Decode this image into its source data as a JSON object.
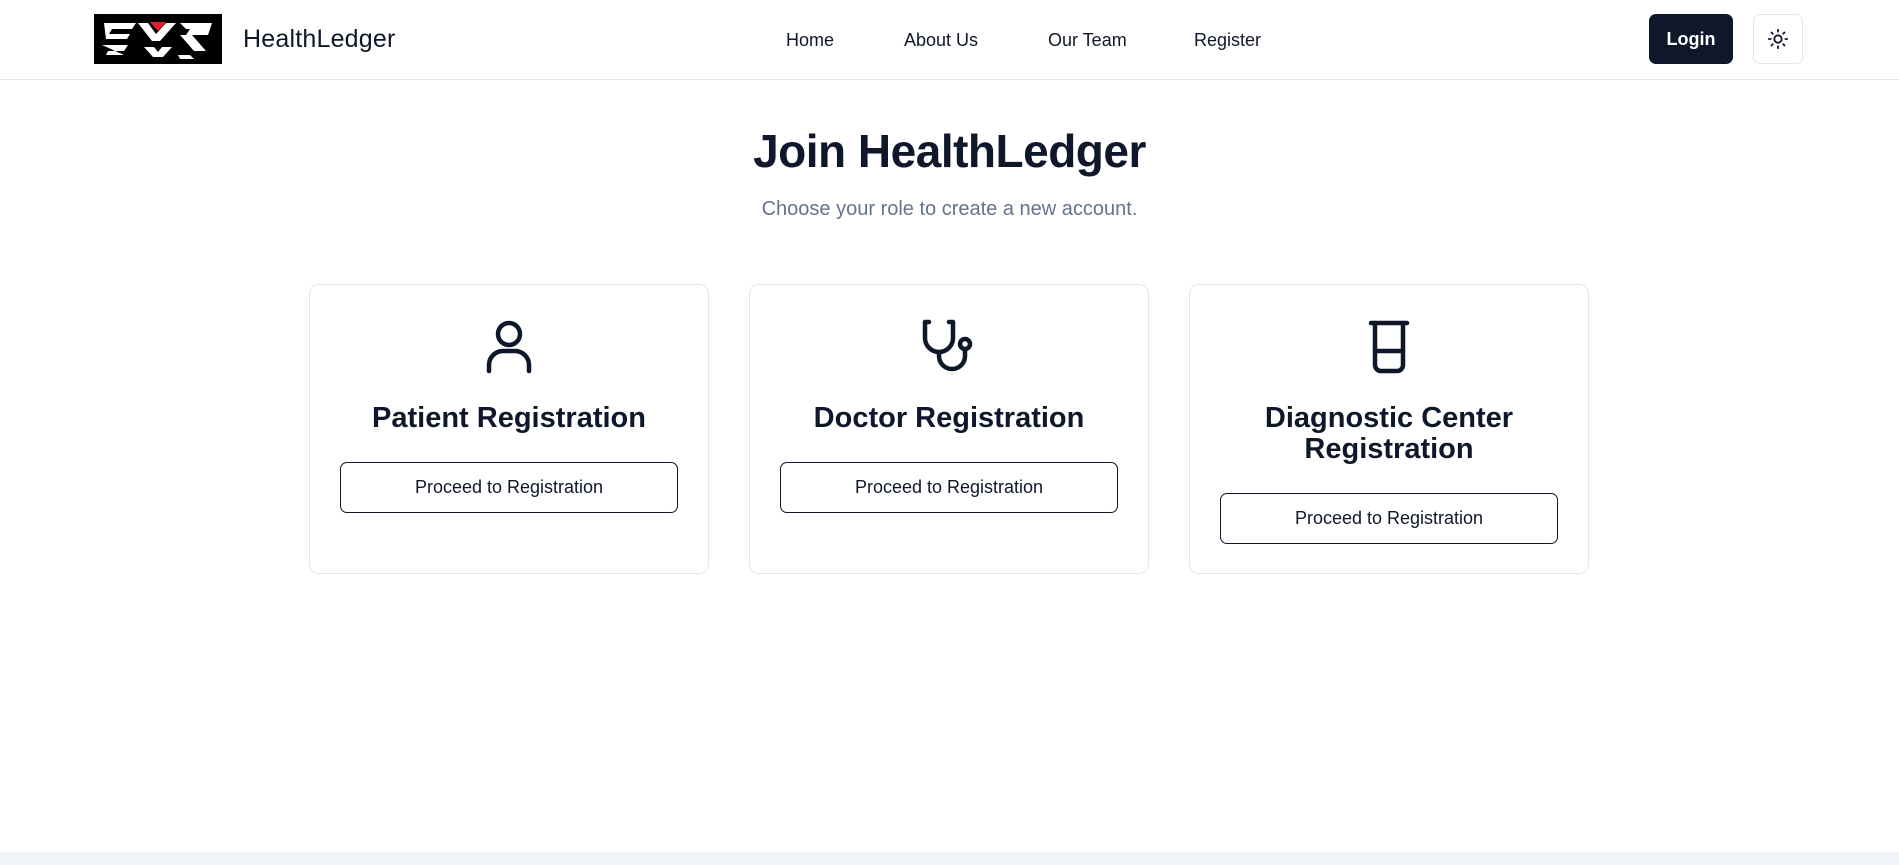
{
  "brand": {
    "logo_text": "EHR",
    "name": "HealthLedger"
  },
  "nav": {
    "items": [
      {
        "label": "Home"
      },
      {
        "label": "About Us"
      },
      {
        "label": "Our Team"
      },
      {
        "label": "Register"
      }
    ],
    "login_label": "Login",
    "theme_icon": "sun-icon"
  },
  "hero": {
    "title": "Join HealthLedger",
    "subtitle": "Choose your role to create a new account."
  },
  "cards": [
    {
      "icon": "user-icon",
      "title": "Patient Registration",
      "button_label": "Proceed to Registration"
    },
    {
      "icon": "stethoscope-icon",
      "title": "Doctor Registration",
      "button_label": "Proceed to Registration"
    },
    {
      "icon": "beaker-icon",
      "title": "Diagnostic Center Registration",
      "button_label": "Proceed to Registration"
    }
  ],
  "colors": {
    "primary": "#0f172a",
    "muted_text": "#64748b",
    "border": "#e5e7eb",
    "logo_accent": "#e11d2e"
  }
}
